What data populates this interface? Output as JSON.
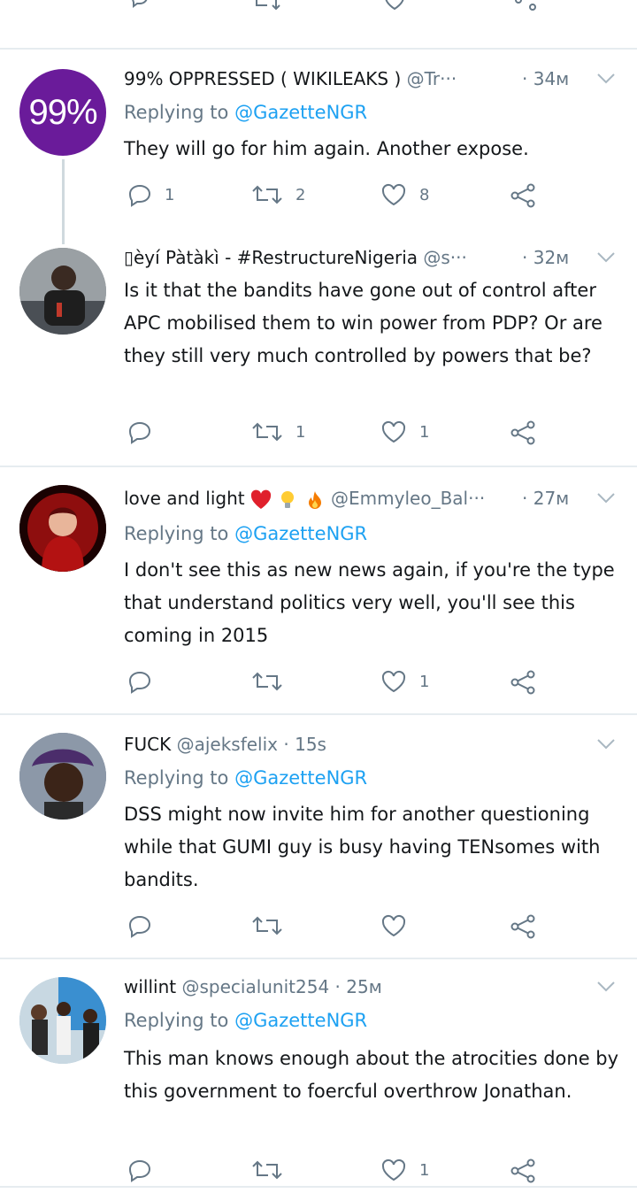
{
  "tweets": [
    {
      "avatar_text": "99%",
      "name": "99% OPPRESSED ( WIKILEAKS )",
      "handle": "@Tr···",
      "time": "· 34м",
      "replying_label": "Replying to",
      "replying_to": "@GazetteNGR",
      "text": "They will go for him again. Another expose.",
      "replies": "1",
      "retweets": "2",
      "likes": "8"
    },
    {
      "name": "▯èyí Pàtàkì - #RestructureNigeria",
      "handle": "@s···",
      "time": "· 32м",
      "text": "Is it that the bandits have gone out of control after APC mobilised them to win power from PDP? Or are they still very much controlled by powers that be?",
      "replies": "",
      "retweets": "1",
      "likes": "1"
    },
    {
      "name": "love and light",
      "emojis": [
        "heart-emoji",
        "lightbulb-emoji",
        "fire-emoji"
      ],
      "handle": "@Emmyleo_Bal···",
      "time": "· 27м",
      "replying_label": "Replying to",
      "replying_to": "@GazetteNGR",
      "text": "I don't see this as new news again, if you're the type that understand politics very well, you'll see this coming in 2015",
      "replies": "",
      "retweets": "",
      "likes": "1"
    },
    {
      "name": "FUCK",
      "handle": "@ajeksfelix",
      "time": "· 15s",
      "replying_label": "Replying to",
      "replying_to": "@GazetteNGR",
      "text": "DSS might now invite him for another questioning while that GUMI guy is busy having TENsomes with bandits.",
      "replies": "",
      "retweets": "",
      "likes": ""
    },
    {
      "name": "willint",
      "handle": "@specialunit254",
      "time": "· 25м",
      "replying_label": "Replying to",
      "replying_to": "@GazetteNGR",
      "text": "This man knows enough about the atrocities done by this government to foercful overthrow Jonathan.",
      "replies": "",
      "retweets": "",
      "likes": "1"
    }
  ],
  "colors": {
    "accent": "#1da1f2",
    "muted": "#657786",
    "purple_avatar": "#6a1b9a",
    "divider": "#e6ecf0"
  }
}
